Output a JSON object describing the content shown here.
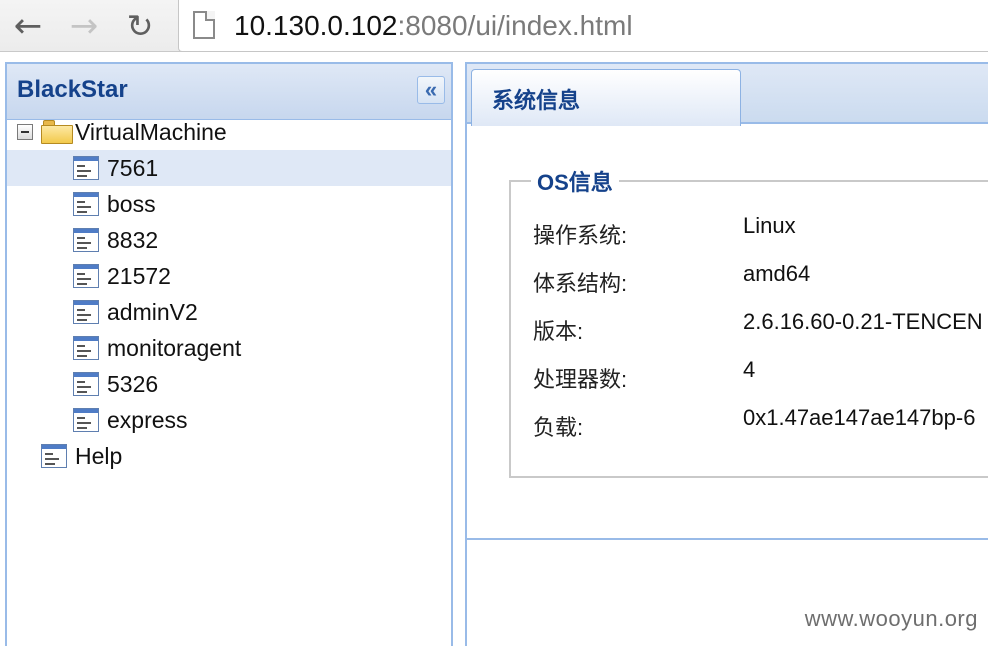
{
  "browser": {
    "back_icon": "←",
    "forward_icon": "→",
    "reload_icon": "↻",
    "url_host": "10.130.0.102",
    "url_rest": ":8080/ui/index.html"
  },
  "west": {
    "title": "BlackStar",
    "collapse_icon": "«",
    "tree": {
      "root_label": "VirtualMachine",
      "children": [
        "7561",
        "boss",
        "8832",
        "21572",
        "adminV2",
        "monitoragent",
        "5326",
        "express"
      ],
      "selected": "7561",
      "help_label": "Help"
    }
  },
  "center": {
    "tab_label": "系统信息",
    "section_title": "OS信息",
    "rows": [
      {
        "key": "操作系统:",
        "value": "Linux"
      },
      {
        "key": "体系结构:",
        "value": "amd64"
      },
      {
        "key": "版本:",
        "value": "2.6.16.60-0.21-TENCEN"
      },
      {
        "key": "处理器数:",
        "value": "4"
      },
      {
        "key": "负载:",
        "value": "0x1.47ae147ae147bp-6"
      }
    ]
  },
  "watermark": "www.wooyun.org"
}
